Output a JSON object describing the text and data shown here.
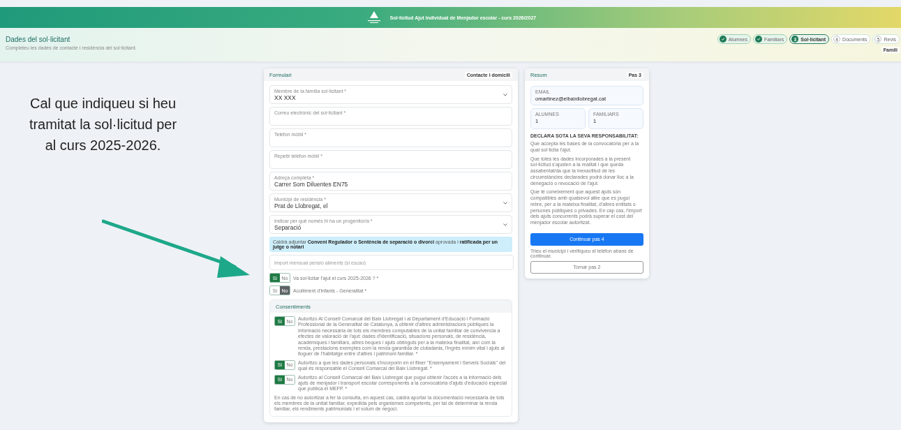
{
  "topbar": {
    "title": "Sol·licitud Ajut Individual de Menjador escolar - curs 2026/2027"
  },
  "page_header": {
    "title": "Dades del sol·licitant",
    "subtitle": "Completeu les dades de contacte i residència del sol·licitant."
  },
  "steps": [
    {
      "label": "Alumnes",
      "done": true,
      "selected": false
    },
    {
      "label": "Familiars",
      "done": true,
      "selected": false
    },
    {
      "number": "3",
      "label": "Sol·licitant",
      "done": false,
      "selected": true
    },
    {
      "number": "4",
      "label": "Documents",
      "done": false,
      "selected": false
    },
    {
      "number": "5",
      "label": "Revis",
      "done": false,
      "selected": false
    }
  ],
  "step_badge": "Famili",
  "annotation": {
    "text": "Cal que indiqueu si heu tramitat la sol·licitud per al curs 2025-2026."
  },
  "form": {
    "title": "Formulari",
    "badge": "Contacte i domicili",
    "fields": [
      {
        "kind": "select",
        "label": "Membre de la família sol·licitant *",
        "value": "XX XXX"
      },
      {
        "kind": "text",
        "label": "Correu electrònic del sol·licitant *"
      },
      {
        "kind": "text",
        "label": "Telèfon mòbil *"
      },
      {
        "kind": "text",
        "label": "Repetir telèfon mòbil *"
      },
      {
        "kind": "text",
        "label": "Adreça completa *",
        "value": "Carrer Som Diluentes EN75"
      },
      {
        "kind": "select",
        "label": "Municipi de residència *",
        "value": "Prat de Llobregat, el"
      },
      {
        "kind": "select",
        "label": "Indicar per què només hi ha un progenitor/a *",
        "value": "Separació"
      }
    ],
    "info": "Caldrà adjuntar **Conveni Regulador o Sentència de separació o divorci** aprovada i **ratificada per un jutge o notari**",
    "amount_field": {
      "placeholder": "Import mensual pensió aliments (si escau)"
    },
    "toggles": [
      {
        "yes": "Sí",
        "no": "No",
        "on": true,
        "label": "Va sol·licitar l'ajut el curs 2025-2026 ? *"
      },
      {
        "yes": "Sí",
        "no": "No",
        "on": false,
        "label": "Acolliment d'infants - Generalitat *"
      }
    ],
    "consents": {
      "title": "Consentiments",
      "items": [
        {
          "yes": "Sí",
          "no": "No",
          "on": true,
          "text": "Autoritzo Al Consell Comarcal del Baix Llobregat i al Departament d'Educació i Formació Professional de la Generalitat de Catalunya, a obtenir d'altres administracions públiques la informació necessària de tots els membres computables de la unitat familiar de convivència a efectes de valoració de l'ajut: dades d'identificació, situacions personals, de residència, acadèmiques i familiars, altres beques i ajuts obtinguts per a la mateixa finalitat, així com la renda, prestacions exemptes com la renda garantida de ciutadania, l'ingrés mínim vital i ajuts al lloguer de l'habitatge entre d'altres i patrimoni familiar. *"
        },
        {
          "yes": "Sí",
          "no": "No",
          "on": true,
          "text": "Autoritzo a que les dades personals s'incorporin en el fitxer \"Ensenyament i Serveis Socials\" del qual és responsable el Consell Comarcal del Baix Llobregat. *"
        },
        {
          "yes": "Sí",
          "no": "No",
          "on": true,
          "text": "Autoritzo al Consell Comarcal del Baix Llobregat que pugui obtenir l'accés a la informació dels ajuts de menjador i transport escolar corresponents a la convocatòria d'ajuts d'educació especial que publica el MEFP. *"
        }
      ],
      "note": "En cas de no autoritzar a fer la consulta, en aquest cas, caldrà aportar la documentació necessària de tots els membres de la unitat familiar, expedida pels organismes competents, per tal de determinar la renda familiar, els rendiments patrimonials i el volum de negoci."
    }
  },
  "summary": {
    "title": "Resum",
    "badge": "Pas 3",
    "email": {
      "label": "EMAIL",
      "value": "omartinez@elbaixllobregat.cat"
    },
    "counts": [
      {
        "label": "ALUMNES",
        "value": "1"
      },
      {
        "label": "FAMILIARS",
        "value": "1"
      }
    ],
    "declaration_title": "DECLARA SOTA LA SEVA RESPONSABILITAT:",
    "declaration": [
      "Que accepta les bases de la convocatòria per a la qual sol·licita l'ajut.",
      "Que totes les dades incorporades a la present sol·licitud s'ajusten a la realitat i que queda assabentat/da que la inexactitud de les circumstàncies declarades podrà donar lloc a la denegació o revocació de l'ajut.",
      "Que té coneixement que aquest ajuts són compatibles amb qualsevol altre que es pugui rebre, per a la mateixa finalitat, d'altres entitats o persones públiques o privades. En cap cas, l'import dels ajuts concurrents podrà superar el cost del menjador escolar autoritzat."
    ],
    "primary_button": "Continuar pas 4",
    "hint": "Trieu el municipi i verifiqueu el telèfon abans de continuar.",
    "secondary_button": "Tornar pas 2"
  }
}
